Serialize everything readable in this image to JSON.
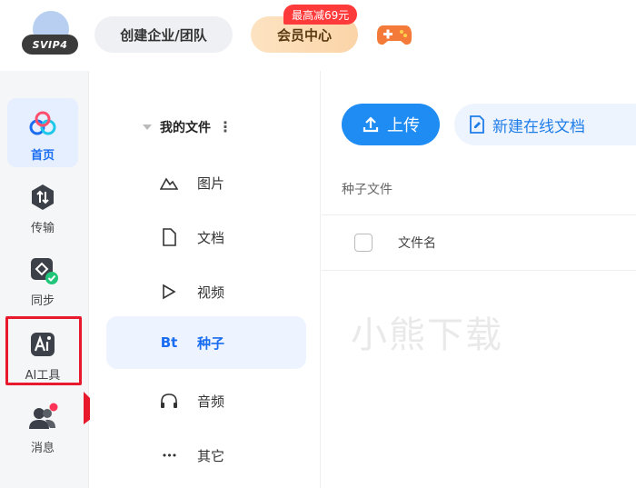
{
  "header": {
    "logo_text": "SVIP4",
    "team_button": "创建企业/团队",
    "vip_button": "会员中心",
    "promo_badge": "最高减69元",
    "game_icon": "gamepad-icon"
  },
  "rail": {
    "items": [
      {
        "label": "首页",
        "icon": "cloud-home-icon",
        "active": true
      },
      {
        "label": "传输",
        "icon": "transfer-icon",
        "active": false
      },
      {
        "label": "同步",
        "icon": "sync-icon",
        "active": false
      },
      {
        "label": "AI工具",
        "icon": "ai-tool-icon",
        "active": false
      },
      {
        "label": "消息",
        "icon": "message-users-icon",
        "active": false
      }
    ]
  },
  "tree": {
    "header": "我的文件",
    "items": [
      {
        "label": "图片",
        "icon": "image-mountain-icon",
        "glyph": "⛰"
      },
      {
        "label": "文档",
        "icon": "document-icon",
        "glyph": ""
      },
      {
        "label": "视频",
        "icon": "play-icon",
        "glyph": "▷"
      },
      {
        "label": "种子",
        "icon": "bt-icon",
        "glyph": "Bt",
        "active": true
      },
      {
        "label": "音频",
        "icon": "headphones-icon",
        "glyph": ""
      },
      {
        "label": "其它",
        "icon": "more-dots-icon",
        "glyph": "•••"
      }
    ]
  },
  "main": {
    "upload_label": "上传",
    "new_doc_label": "新建在线文档",
    "breadcrumb": "种子文件",
    "column_filename": "文件名",
    "watermark": "小熊下载"
  },
  "colors": {
    "accent": "#1f8cf3",
    "active_bg": "#e5efff",
    "highlight": "#e8192c"
  }
}
